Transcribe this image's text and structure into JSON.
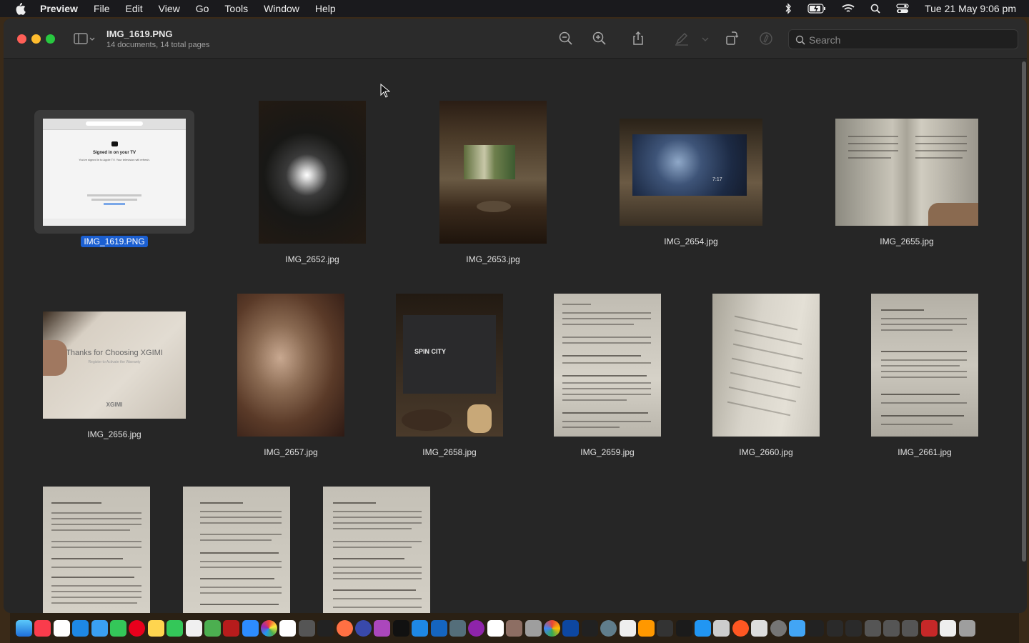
{
  "menubar": {
    "app_name": "Preview",
    "items": [
      "File",
      "Edit",
      "View",
      "Go",
      "Tools",
      "Window",
      "Help"
    ],
    "datetime": "Tue 21 May  9:06 pm"
  },
  "window": {
    "title": "IMG_1619.PNG",
    "subtitle": "14 documents, 14 total pages",
    "search_placeholder": "Search"
  },
  "thumbnails": [
    {
      "name": "IMG_1619.PNG",
      "selected": true
    },
    {
      "name": "IMG_2652.jpg"
    },
    {
      "name": "IMG_2653.jpg"
    },
    {
      "name": "IMG_2654.jpg"
    },
    {
      "name": "IMG_2655.jpg"
    },
    {
      "name": "IMG_2656.jpg"
    },
    {
      "name": "IMG_2657.jpg"
    },
    {
      "name": "IMG_2658.jpg"
    },
    {
      "name": "IMG_2659.jpg"
    },
    {
      "name": "IMG_2660.jpg"
    },
    {
      "name": "IMG_2661.jpg"
    },
    {
      "name": ""
    },
    {
      "name": ""
    },
    {
      "name": ""
    }
  ],
  "screenshot_texts": {
    "signed_in_title": "Signed in on your TV",
    "signed_in_sub": "You've signed in to Apple TV. Your television will refresh.",
    "projector_card": "Thanks for Choosing XGIMI",
    "projector_card_sub": "Register to Activate the Warranty",
    "projector_brand": "XGIMI",
    "tv_title": "SPIN CITY",
    "tv_clock": "7:17"
  }
}
